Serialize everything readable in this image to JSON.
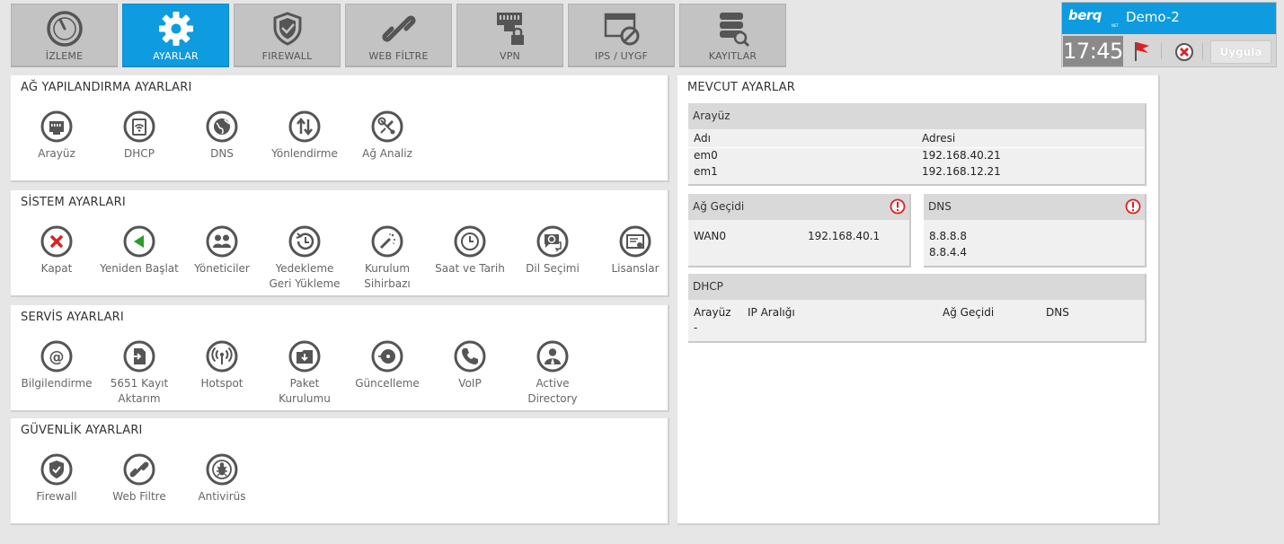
{
  "tabs": [
    {
      "label": "İZLEME",
      "icon": "gauge-icon"
    },
    {
      "label": "AYARLAR",
      "icon": "gear-icon"
    },
    {
      "label": "FIREWALL",
      "icon": "shield-icon"
    },
    {
      "label": "WEB FİLTRE",
      "icon": "link-icon"
    },
    {
      "label": "VPN",
      "icon": "vpn-lock-icon"
    },
    {
      "label": "IPS / UYGF",
      "icon": "blocked-window-icon"
    },
    {
      "label": "KAYITLAR",
      "icon": "database-search-icon"
    }
  ],
  "brand": {
    "logo": "berq",
    "logo_sub": "NET",
    "device_name": "Demo-2",
    "time": "17:45",
    "apply_label": "Uygula"
  },
  "network": {
    "title": "AĞ YAPILANDIRMA AYARLARI",
    "items": [
      {
        "label": "Arayüz",
        "icon": "network-port-icon"
      },
      {
        "label": "DHCP",
        "icon": "dhcp-icon"
      },
      {
        "label": "DNS",
        "icon": "globe-icon"
      },
      {
        "label": "Yönlendirme",
        "icon": "routing-arrows-icon"
      },
      {
        "label": "Ağ Analiz",
        "icon": "network-analysis-icon"
      }
    ]
  },
  "system": {
    "title": "SİSTEM AYARLARI",
    "items": [
      {
        "label": "Kapat",
        "icon": "shutdown-x-icon"
      },
      {
        "label": "Yeniden Başlat",
        "icon": "restart-icon"
      },
      {
        "label": "Yöneticiler",
        "icon": "users-icon"
      },
      {
        "label": "Yedekleme Geri Yükleme",
        "icon": "backup-restore-icon"
      },
      {
        "label": "Kurulum Sihirbazı",
        "icon": "wizard-wand-icon"
      },
      {
        "label": "Saat ve Tarih",
        "icon": "clock-icon"
      },
      {
        "label": "Dil Seçimi",
        "icon": "language-icon"
      },
      {
        "label": "Lisanslar",
        "icon": "license-certificate-icon"
      }
    ]
  },
  "services": {
    "title": "SERVİS AYARLARI",
    "items": [
      {
        "label": "Bilgilendirme",
        "icon": "at-sign-icon"
      },
      {
        "label": "5651 Kayıt Aktarım",
        "icon": "document-export-icon"
      },
      {
        "label": "Hotspot",
        "icon": "hotspot-icon"
      },
      {
        "label": "Paket Kurulumu",
        "icon": "package-install-icon"
      },
      {
        "label": "Güncelleme",
        "icon": "update-disc-icon"
      },
      {
        "label": "VoIP",
        "icon": "phone-icon"
      },
      {
        "label": "Active Directory",
        "icon": "active-directory-icon"
      }
    ]
  },
  "security": {
    "title": "GÜVENLİK AYARLARI",
    "items": [
      {
        "label": "Firewall",
        "icon": "shield-icon"
      },
      {
        "label": "Web Filtre",
        "icon": "link-icon"
      },
      {
        "label": "Antivirüs",
        "icon": "antivirus-bug-icon"
      }
    ]
  },
  "current": {
    "title": "MEVCUT AYARLAR",
    "interface": {
      "title": "Arayüz",
      "col_name": "Adı",
      "col_address": "Adresi",
      "rows": [
        {
          "name": "em0",
          "address": "192.168.40.21"
        },
        {
          "name": "em1",
          "address": "192.168.12.21"
        }
      ]
    },
    "gateway": {
      "title": "Ağ Geçidi",
      "name": "WAN0",
      "address": "192.168.40.1"
    },
    "dns": {
      "title": "DNS",
      "servers": [
        "8.8.8.8",
        "8.8.4.4"
      ]
    },
    "dhcp": {
      "title": "DHCP",
      "col_interface": "Arayüz",
      "col_range": "IP Aralığı",
      "col_gateway": "Ağ Geçidi",
      "col_dns": "DNS",
      "row_interface": "-"
    }
  },
  "colors": {
    "accent": "#0e9be0",
    "icon_ring": "#555555",
    "danger": "#e02020",
    "restart": "#2a9d2a"
  }
}
